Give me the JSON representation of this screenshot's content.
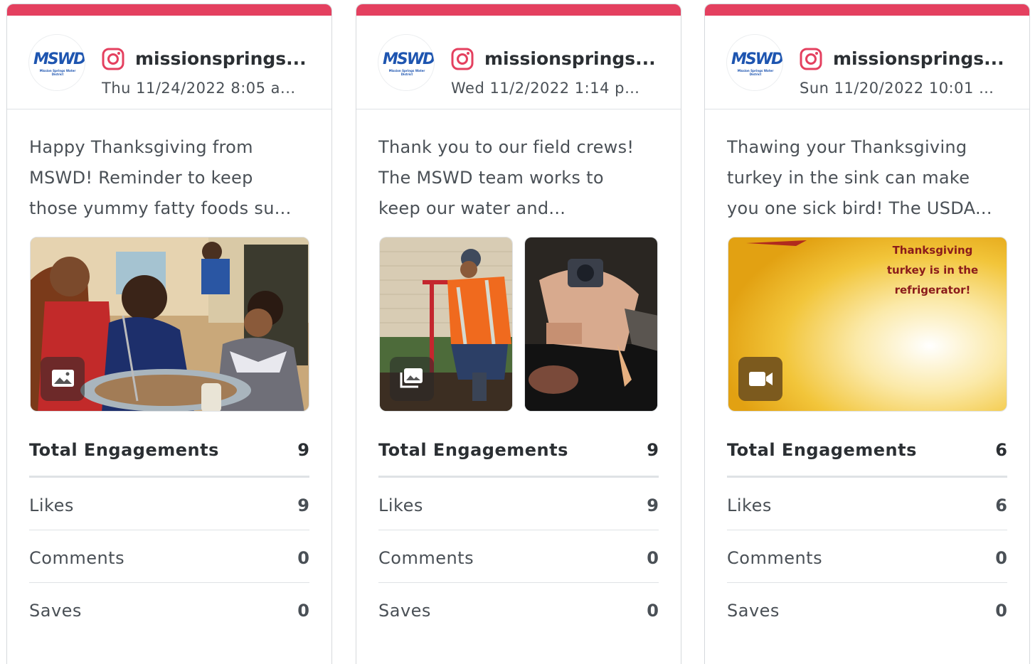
{
  "theme": {
    "accent": "#e4405f",
    "text": "#4a5056",
    "border": "#dfe2e5"
  },
  "posts": [
    {
      "account": "missionsprings...",
      "date": "Thu 11/24/2022 8:05 a...",
      "caption": [
        "Happy Thanksgiving from",
        "MSWD! Reminder to keep",
        "those yummy fatty foods su..."
      ],
      "media_type": "image-icon",
      "stats": {
        "total_label": "Total Engagements",
        "total": "9",
        "likes_label": "Likes",
        "likes": "9",
        "comments_label": "Comments",
        "comments": "0",
        "saves_label": "Saves",
        "saves": "0"
      }
    },
    {
      "account": "missionsprings...",
      "date": "Wed 11/2/2022 1:14 pm...",
      "caption": [
        "Thank you to our field crews!",
        "The MSWD team works to",
        "keep our water and..."
      ],
      "media_type": "gallery-icon",
      "stats": {
        "total_label": "Total Engagements",
        "total": "9",
        "likes_label": "Likes",
        "likes": "9",
        "comments_label": "Comments",
        "comments": "0",
        "saves_label": "Saves",
        "saves": "0"
      }
    },
    {
      "account": "missionsprings...",
      "date": "Sun 11/20/2022 10:01 a...",
      "caption": [
        "Thawing your Thanksgiving",
        "turkey in the sink can make",
        "you one sick bird! The USDA..."
      ],
      "media_type": "video-icon",
      "media_text": [
        "Thanksgiving",
        "turkey is in the",
        "refrigerator!"
      ],
      "stats": {
        "total_label": "Total Engagements",
        "total": "6",
        "likes_label": "Likes",
        "likes": "6",
        "comments_label": "Comments",
        "comments": "0",
        "saves_label": "Saves",
        "saves": "0"
      }
    }
  ],
  "logo": {
    "main": "MSWD",
    "sub": "Mission Springs Water District"
  }
}
